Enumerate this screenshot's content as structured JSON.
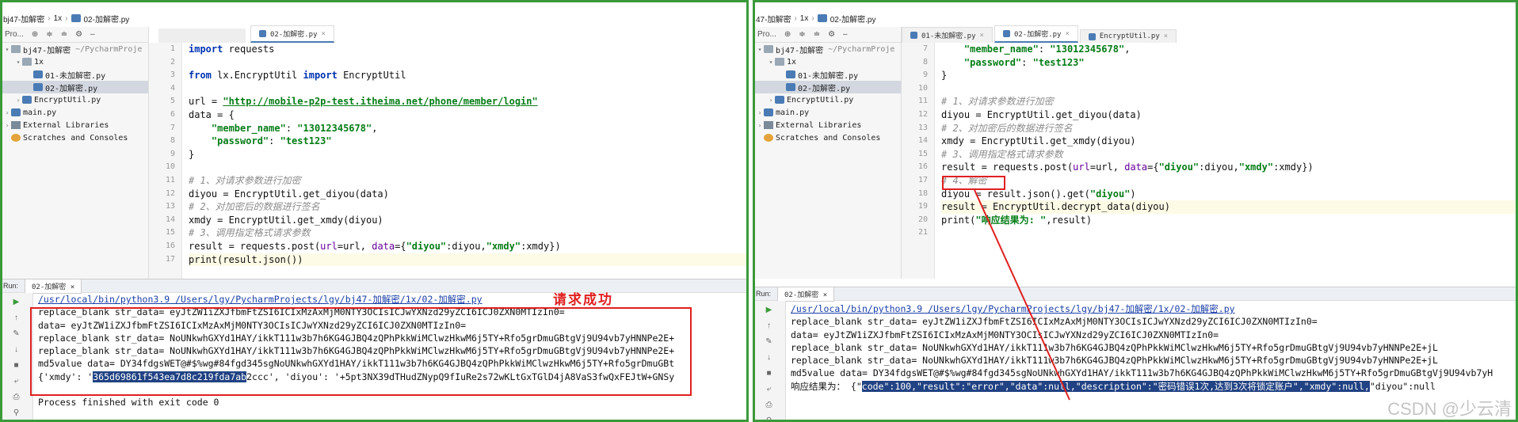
{
  "left": {
    "breadcrumbs": [
      "bj47-加解密",
      "1x",
      "02-加解密.py"
    ],
    "project_label": "Pro...",
    "tree": [
      {
        "label": "bj47-加解密",
        "sub": "~/PycharmProje",
        "kind": "folder",
        "arrow": "▾",
        "indent": 0
      },
      {
        "label": "1x",
        "kind": "folder",
        "arrow": "▾",
        "indent": 1
      },
      {
        "label": "01-未加解密.py",
        "kind": "py",
        "arrow": "",
        "indent": 2
      },
      {
        "label": "02-加解密.py",
        "kind": "py",
        "arrow": "",
        "indent": 2,
        "selected": true
      },
      {
        "label": "EncryptUtil.py",
        "kind": "py",
        "arrow": "›",
        "indent": 1
      },
      {
        "label": "main.py",
        "kind": "py",
        "arrow": "›",
        "indent": 0
      },
      {
        "label": "External Libraries",
        "kind": "lib",
        "arrow": "›",
        "indent": 0
      },
      {
        "label": "Scratches and Consoles",
        "kind": "scr",
        "arrow": "",
        "indent": 0
      }
    ],
    "tabs": [
      {
        "label": "02-加解密.py",
        "active": true
      }
    ],
    "line_numbers": [
      "1",
      "2",
      "3",
      "4",
      "5",
      "6",
      "7",
      "8",
      "9",
      "10",
      "11",
      "12",
      "13",
      "14",
      "15",
      "16",
      "17"
    ],
    "run_label": "Run:",
    "run_tab": "02-加解密",
    "console": {
      "cmd": "/usr/local/bin/python3.9 /Users/lgy/PycharmProjects/lgy/bj47-加解密/1x/02-加解密.py",
      "lines": [
        "replace_blank str_data= eyJtZW1iZXJfbmFtZSI6ICIxMzAxMjM0NTY3OCIsICJwYXNzd29yZCI6ICJ0ZXN0MTIzIn0=",
        "data= eyJtZW1iZXJfbmFtZSI6ICIxMzAxMjM0NTY3OCIsICJwYXNzd29yZCI6ICJ0ZXN0MTIzIn0=",
        "replace_blank str_data= NoUNkwhGXYd1HAY/ikkT111w3b7h6KG4GJBQ4zQPhPkkWiMClwzHkwM6j5TY+Rfo5grDmuGBtgVj9U94vb7yHNNPe2E+",
        "replace_blank str_data= NoUNkwhGXYd1HAY/ikkT111w3b7h6KG4GJBQ4zQPhPkkWiMClwzHkwM6j5TY+Rfo5grDmuGBtgVj9U94vb7yHNNPe2E+",
        "md5value data= DY34fdgsWET@#$%wg#84fgd345sgNoUNkwhGXYd1HAY/ikkT111w3b7h6KG4GJBQ4zQPhPkkWiMClwzHkwM6j5TY+Rfo5grDmuGBt"
      ],
      "xmdy_prefix": "{'xmdy': '",
      "xmdy_selected": "365d69861f543ea7d8c219fda7ab",
      "xmdy_rest": "2ccc', 'diyou': '+5pt3NX39dTHudZNypQ9fIuRe2s72wKLtGxTGlD4jA8VaS3fwQxFEJtW+GNSy",
      "finish": "Process finished with exit code 0"
    },
    "annotation": "请求成功"
  },
  "right": {
    "breadcrumbs": [
      "47-加解密",
      "1x",
      "02-加解密.py"
    ],
    "project_label": "Pro...",
    "tree": [
      {
        "label": "bj47-加解密",
        "sub": "~/PycharmProje",
        "kind": "folder",
        "arrow": "▾",
        "indent": 0
      },
      {
        "label": "1x",
        "kind": "folder",
        "arrow": "▾",
        "indent": 1
      },
      {
        "label": "01-未加解密.py",
        "kind": "py",
        "arrow": "",
        "indent": 2
      },
      {
        "label": "02-加解密.py",
        "kind": "py",
        "arrow": "",
        "indent": 2,
        "selected": true
      },
      {
        "label": "EncryptUtil.py",
        "kind": "py",
        "arrow": "›",
        "indent": 1
      },
      {
        "label": "main.py",
        "kind": "py",
        "arrow": "›",
        "indent": 0
      },
      {
        "label": "External Libraries",
        "kind": "lib",
        "arrow": "›",
        "indent": 0
      },
      {
        "label": "Scratches and Consoles",
        "kind": "scr",
        "arrow": "",
        "indent": 0
      }
    ],
    "tabs": [
      {
        "label": "01-未加解密.py",
        "active": false
      },
      {
        "label": "02-加解密.py",
        "active": true
      },
      {
        "label": "EncryptUtil.py",
        "active": false
      }
    ],
    "line_numbers": [
      "7",
      "8",
      "9",
      "10",
      "11",
      "12",
      "13",
      "14",
      "15",
      "16",
      "17",
      "18",
      "19",
      "20",
      "21"
    ],
    "run_label": "Run:",
    "run_tab": "02-加解密",
    "console": {
      "cmd": "/usr/local/bin/python3.9 /Users/lgy/PycharmProjects/lgy/bj47-加解密/1x/02-加解密.py",
      "lines": [
        "replace_blank str_data= eyJtZW1iZXJfbmFtZSI6ICIxMzAxMjM0NTY3OCIsICJwYXNzd29yZCI6ICJ0ZXN0MTIzIn0=",
        "data= eyJtZW1iZXJfbmFtZSI6ICIxMzAxMjM0NTY3OCIsICJwYXNzd29yZCI6ICJ0ZXN0MTIzIn0=",
        "replace_blank str_data= NoUNkwhGXYd1HAY/ikkT111w3b7h6KG4GJBQ4zQPhPkkWiMClwzHkwM6j5TY+Rfo5grDmuGBtgVj9U94vb7yHNNPe2E+jL",
        "replace_blank str_data= NoUNkwhGXYd1HAY/ikkT111w3b7h6KG4GJBQ4zQPhPkkWiMClwzHkwM6j5TY+Rfo5grDmuGBtgVj9U94vb7yHNNPe2E+jL",
        "md5value data= DY34fdgsWET@#$%wg#84fgd345sgNoUNkwhGXYd1HAY/ikkT111w3b7h6KG4GJBQ4zQPhPkkWiMClwzHkwM6j5TY+Rfo5grDmuGBtgVj9U94vb7yH"
      ],
      "result_prefix": "响应结果为： {\"",
      "result_selected": "code\":100,\"result\":\"error\",\"data\":null,\"description\":\"密码错误1次,达到3次将锁定账户\",\"xmdy\":null,",
      "result_rest": "\"diyou\":null"
    },
    "watermark": "CSDN @少云清"
  }
}
